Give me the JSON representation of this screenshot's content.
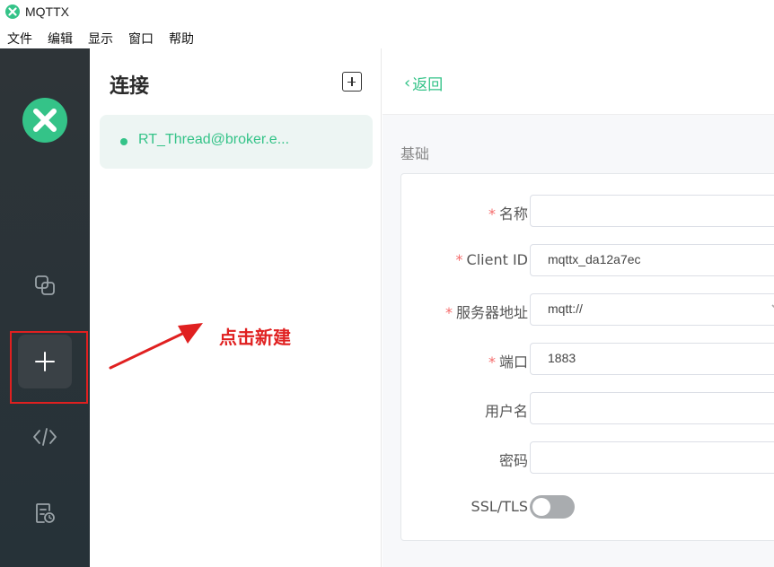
{
  "window": {
    "title": "MQTTX"
  },
  "menu": [
    "文件",
    "编辑",
    "显示",
    "窗口",
    "帮助"
  ],
  "sidebar": {
    "icons": [
      "connections-icon",
      "add-icon",
      "script-icon",
      "log-icon"
    ]
  },
  "connections": {
    "title": "连接",
    "items": [
      {
        "name": "RT_Thread@broker.e...",
        "status": "online"
      }
    ]
  },
  "annotation": {
    "text": "点击新建"
  },
  "main": {
    "back_label": "返回",
    "section_title": "基础",
    "fields": {
      "name": {
        "label": "名称",
        "required": true,
        "value": ""
      },
      "client_id": {
        "label": "Client ID",
        "required": true,
        "value": "mqttx_da12a7ec"
      },
      "host": {
        "label": "服务器地址",
        "required": true,
        "value": "mqtt://"
      },
      "port": {
        "label": "端口",
        "required": true,
        "value": "1883"
      },
      "username": {
        "label": "用户名",
        "required": false,
        "value": ""
      },
      "password": {
        "label": "密码",
        "required": false,
        "value": ""
      },
      "ssl": {
        "label": "SSL/TLS",
        "enabled": false
      }
    },
    "required_mark": "*"
  },
  "colors": {
    "accent": "#34c388",
    "sidebar": "#2b3236",
    "annotation": "#e02020"
  }
}
